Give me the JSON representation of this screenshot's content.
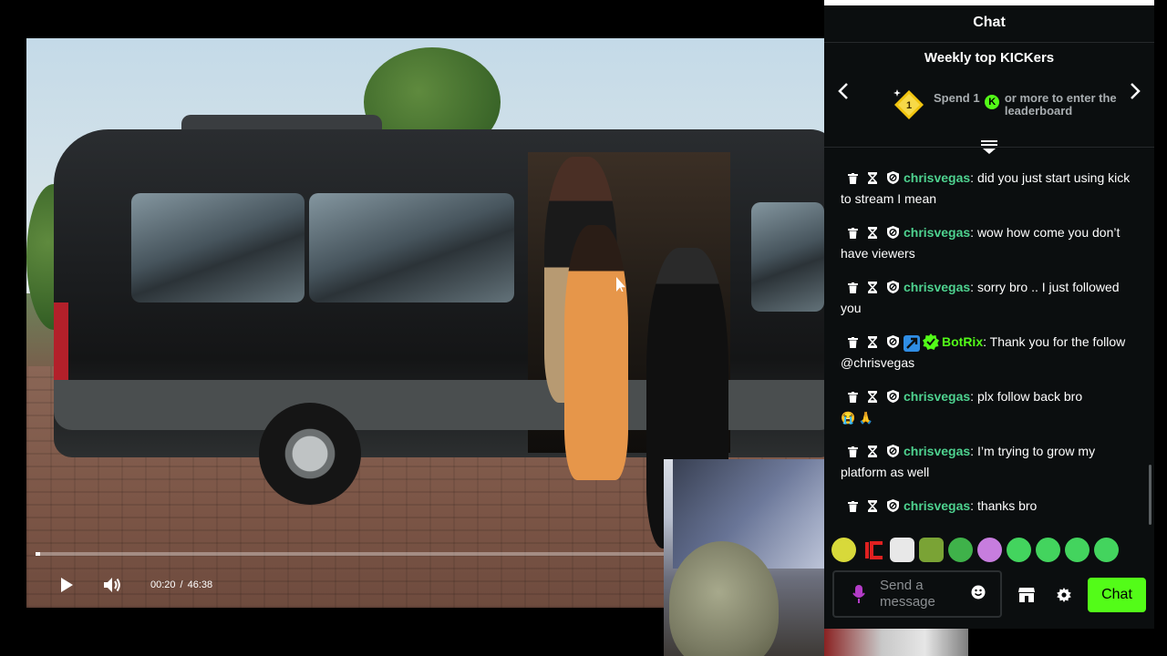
{
  "video": {
    "current_time": "00:20",
    "separator": "/",
    "duration": "46:38",
    "progress": 0.007
  },
  "chat": {
    "title": "Chat",
    "leaderboard": {
      "title": "Weekly top KICKers",
      "rank_badge": "1",
      "text_before": "Spend 1",
      "coin_label": "K",
      "text_after": "or more to enter the leaderboard"
    },
    "messages": [
      {
        "username": "chrisvegas",
        "text": ": did you just start using kick to stream I mean"
      },
      {
        "username": "chrisvegas",
        "text": ": wow how come you don’t have viewers"
      },
      {
        "username": "chrisvegas",
        "text": ": sorry bro .. I just followed you"
      },
      {
        "username": "BotRix",
        "text": ": Thank you for the follow @chrisvegas",
        "is_bot": true
      },
      {
        "username": "chrisvegas",
        "text": ": plx follow back bro",
        "emojis": "😭 🙏"
      },
      {
        "username": "chrisvegas",
        "text": ": I’m trying to grow my platform as well"
      },
      {
        "username": "chrisvegas",
        "text": ": thanks bro"
      }
    ],
    "input_placeholder": "Send a message",
    "send_label": "Chat"
  },
  "colors": {
    "accent": "#53fc18",
    "username": "#4ed28f",
    "panel_bg": "#0b0e0f"
  },
  "icons": [
    "trash-icon",
    "timeout-icon",
    "ban-icon",
    "chevron-left-icon",
    "chevron-right-icon",
    "mic-icon",
    "smiley-icon",
    "store-icon",
    "gear-icon",
    "play-icon",
    "volume-icon"
  ]
}
